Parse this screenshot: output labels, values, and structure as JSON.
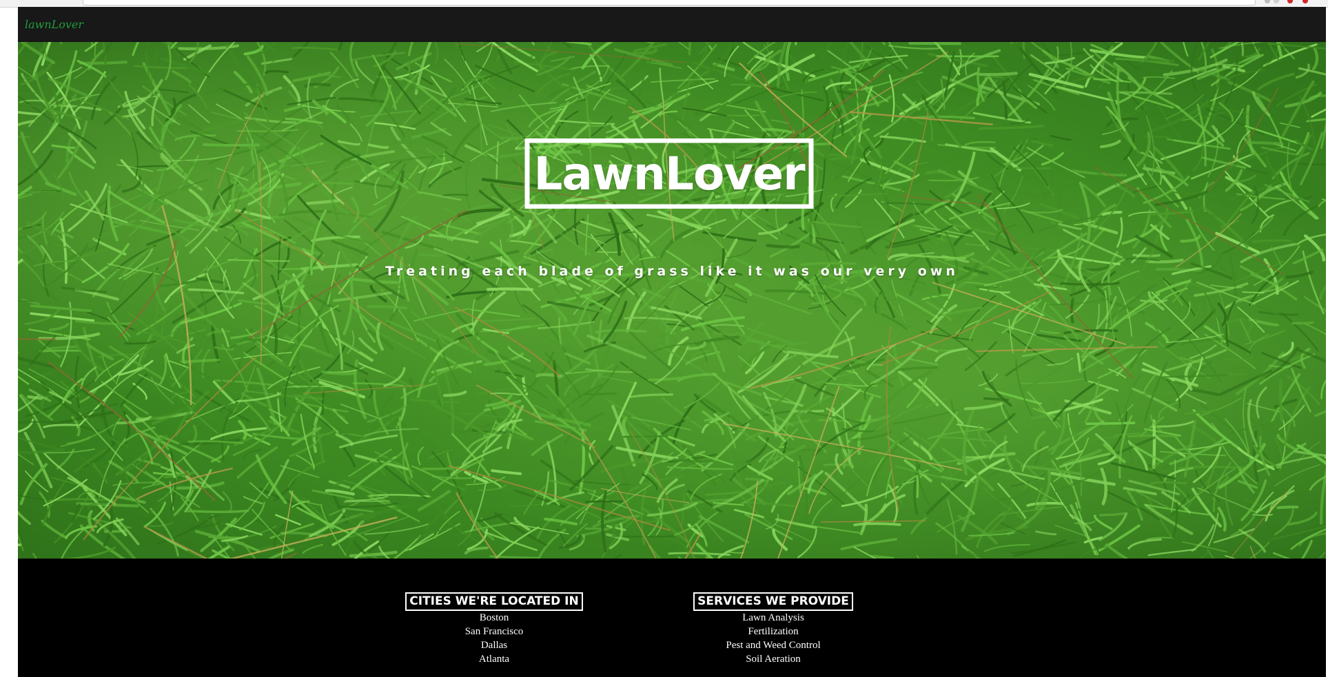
{
  "navbar": {
    "logo_text": "lawnLover"
  },
  "hero": {
    "title": "LawnLover",
    "tagline": "Treating each blade of grass like it was our very own"
  },
  "footer": {
    "cities": {
      "heading": "CITIES WE'RE LOCATED IN",
      "items": [
        "Boston",
        "San Francisco",
        "Dallas",
        "Atlanta"
      ]
    },
    "services": {
      "heading": "SERVICES WE PROVIDE",
      "items": [
        "Lawn Analysis",
        "Fertilization",
        "Pest and Weed Control",
        "Soil Aeration"
      ]
    }
  },
  "colors": {
    "navbar_bg": "#181818",
    "logo_green": "#1f9d3a",
    "footer_bg": "#000000",
    "grass_green": "#3d8a22"
  },
  "icons": {
    "hero_background": "grass-photo-icon"
  }
}
